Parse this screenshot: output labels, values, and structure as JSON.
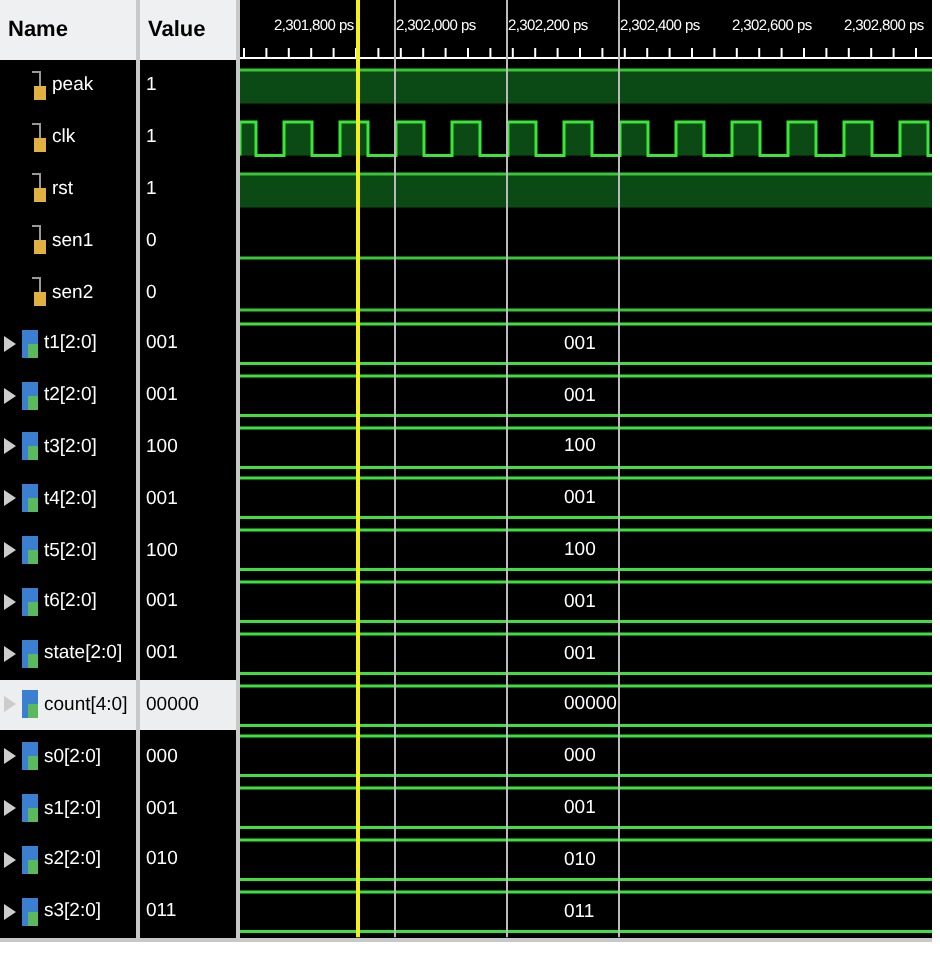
{
  "columns": {
    "name": "Name",
    "value": "Value"
  },
  "ruler": {
    "ticks": [
      "2,301,800 ps",
      "2,302,000 ps",
      "2,302,200 ps",
      "2,302,400 ps",
      "2,302,600 ps",
      "2,302,800 ps"
    ]
  },
  "signals": [
    {
      "name": "peak",
      "value": "1",
      "kind": "high",
      "selected": false
    },
    {
      "name": "clk",
      "value": "1",
      "kind": "clock",
      "selected": false
    },
    {
      "name": "rst",
      "value": "1",
      "kind": "high",
      "selected": false
    },
    {
      "name": "sen1",
      "value": "0",
      "kind": "low",
      "selected": false
    },
    {
      "name": "sen2",
      "value": "0",
      "kind": "low",
      "selected": false
    },
    {
      "name": "t1[2:0]",
      "value": "001",
      "kind": "bus",
      "wave_label": "001",
      "selected": false
    },
    {
      "name": "t2[2:0]",
      "value": "001",
      "kind": "bus",
      "wave_label": "001",
      "selected": false
    },
    {
      "name": "t3[2:0]",
      "value": "100",
      "kind": "bus",
      "wave_label": "100",
      "selected": false
    },
    {
      "name": "t4[2:0]",
      "value": "001",
      "kind": "bus",
      "wave_label": "001",
      "selected": false
    },
    {
      "name": "t5[2:0]",
      "value": "100",
      "kind": "bus",
      "wave_label": "100",
      "selected": false
    },
    {
      "name": "t6[2:0]",
      "value": "001",
      "kind": "bus",
      "wave_label": "001",
      "selected": false
    },
    {
      "name": "state[2:0]",
      "value": "001",
      "kind": "bus",
      "wave_label": "001",
      "selected": false
    },
    {
      "name": "count[4:0]",
      "value": "00000",
      "kind": "bus",
      "wave_label": "00000",
      "selected": true
    },
    {
      "name": "s0[2:0]",
      "value": "000",
      "kind": "bus",
      "wave_label": "000",
      "selected": false
    },
    {
      "name": "s1[2:0]",
      "value": "001",
      "kind": "bus",
      "wave_label": "001",
      "selected": false
    },
    {
      "name": "s2[2:0]",
      "value": "010",
      "kind": "bus",
      "wave_label": "010",
      "selected": false
    },
    {
      "name": "s3[2:0]",
      "value": "011",
      "kind": "bus",
      "wave_label": "011",
      "selected": false
    }
  ]
}
